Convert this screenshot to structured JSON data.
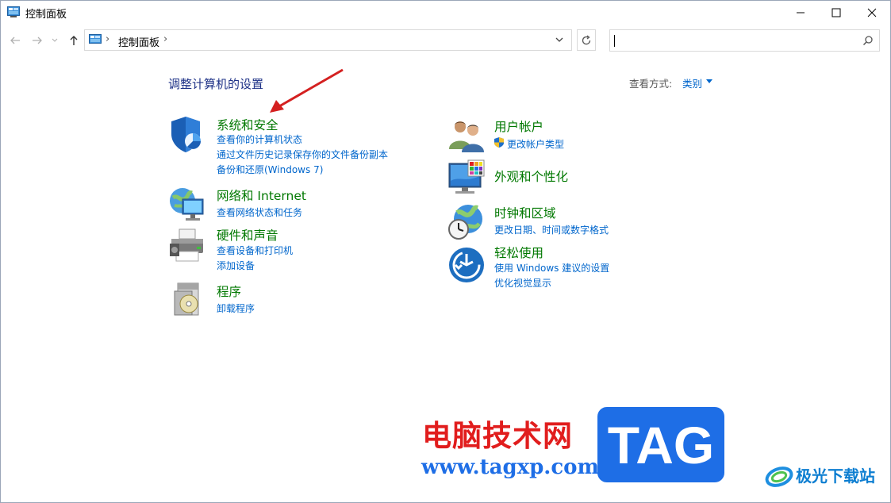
{
  "window": {
    "title": "控制面板",
    "controls": [
      "minimize-icon",
      "maximize-icon",
      "close-icon"
    ]
  },
  "address": {
    "path": "控制面板",
    "separator": "›",
    "search_placeholder": ""
  },
  "content": {
    "heading": "调整计算机的设置",
    "view_by_label": "查看方式:",
    "view_by_value": "类别"
  },
  "categories": {
    "system_security": {
      "title": "系统和安全",
      "icon": "shield-icon",
      "links": [
        "查看你的计算机状态",
        "通过文件历史记录保存你的文件备份副本",
        "备份和还原(Windows 7)"
      ]
    },
    "network": {
      "title": "网络和 Internet",
      "icon": "network-globe-icon",
      "links": [
        "查看网络状态和任务"
      ]
    },
    "hardware": {
      "title": "硬件和声音",
      "icon": "printer-icon",
      "links": [
        "查看设备和打印机",
        "添加设备"
      ]
    },
    "programs": {
      "title": "程序",
      "icon": "programs-disc-icon",
      "links": [
        "卸载程序"
      ]
    },
    "user_accounts": {
      "title": "用户帐户",
      "icon": "users-icon",
      "links": [
        "更改帐户类型"
      ]
    },
    "appearance": {
      "title": "外观和个性化",
      "icon": "monitor-palette-icon",
      "links": []
    },
    "clock_region": {
      "title": "时钟和区域",
      "icon": "clock-globe-icon",
      "links": [
        "更改日期、时间或数字格式"
      ]
    },
    "ease_of_access": {
      "title": "轻松使用",
      "icon": "ease-of-access-icon",
      "links": [
        "使用 Windows 建议的设置",
        "优化视觉显示"
      ]
    }
  },
  "watermark": {
    "site_name": "电脑技术网",
    "url": "www.tagxp.com",
    "badge": "TAG",
    "corner_text": "极光下载站"
  },
  "colors": {
    "category_title": "#007800",
    "link": "#0066cc",
    "heading": "#1e3287",
    "annotation_arrow": "#d42020"
  }
}
